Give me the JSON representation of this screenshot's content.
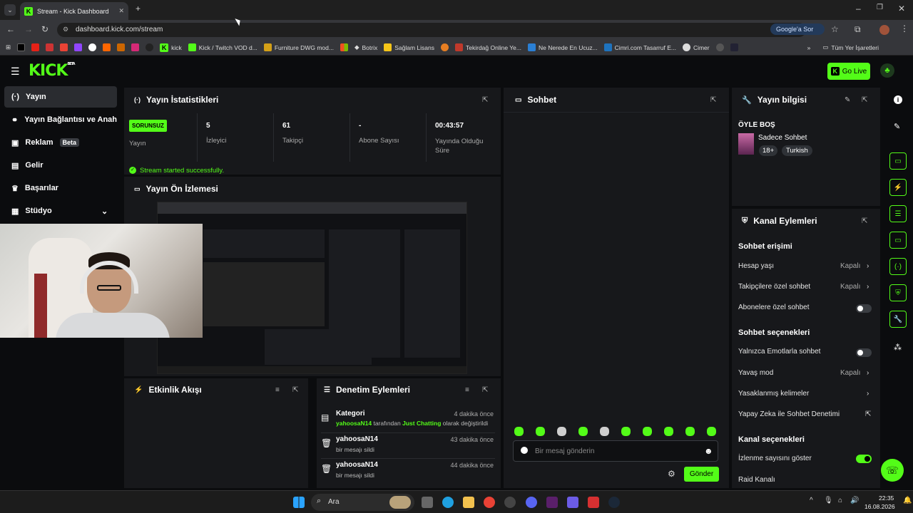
{
  "browser": {
    "tab_title": "Stream - Kick Dashboard",
    "url": "dashboard.kick.com/stream",
    "ask_google": "Google'a Sor",
    "bookmarks": [
      "kick",
      "Kick / Twitch VOD d...",
      "Furniture DWG mod...",
      "Botrix",
      "Sağlam Lisans",
      "Tekirdağ Online Ye...",
      "Ne Nerede En Ucuz...",
      "Cimri.com Tasarruf E...",
      "Cimer"
    ],
    "all_bookmarks": "Tüm Yer İşaretleri"
  },
  "app": {
    "logo": "KICK",
    "logo_sup": "BETA",
    "go_live": "Go Live"
  },
  "sidebar": {
    "items": [
      {
        "label": "Yayın",
        "icon": "broadcast-icon"
      },
      {
        "label": "Yayın Bağlantısı ve Anahtarı",
        "icon": "link-icon"
      },
      {
        "label": "Reklam",
        "icon": "ad-icon",
        "badge": "Beta"
      },
      {
        "label": "Gelir",
        "icon": "chart-icon"
      },
      {
        "label": "Başarılar",
        "icon": "trophy-icon"
      },
      {
        "label": "Stüdyo",
        "icon": "studio-icon"
      }
    ]
  },
  "stats": {
    "title": "Yayın İstatistikleri",
    "status_badge": "SORUNSUZ",
    "status_label": "Yayın",
    "viewers_value": "5",
    "viewers_label": "İzleyici",
    "followers_value": "61",
    "followers_label": "Takipçi",
    "subs_value": "-",
    "subs_label": "Abone Sayısı",
    "uptime_value": "00:43:57",
    "uptime_label": "Yayında Olduğu Süre",
    "success_msg": "Stream started successfully."
  },
  "preview": {
    "title": "Yayın Ön İzlemesi"
  },
  "activity": {
    "title": "Etkinlik Akışı"
  },
  "moderation": {
    "title": "Denetim Eylemleri",
    "items": [
      {
        "title": "Kategori",
        "time": "4 dakika önce",
        "user": "yahoosaN14",
        "mid": " tarafından ",
        "highlight": "Just Chatting",
        "tail": " olarak değiştirildi"
      },
      {
        "title": "yahoosaN14",
        "time": "43 dakika önce",
        "desc": "bir mesajı sildi"
      },
      {
        "title": "yahoosaN14",
        "time": "44 dakika önce",
        "desc": "bir mesajı sildi"
      }
    ]
  },
  "chat": {
    "title": "Sohbet",
    "placeholder": "Bir mesaj gönderin",
    "send": "Gönder"
  },
  "stream_info": {
    "title": "Yayın bilgisi",
    "stream_title": "ÖYLE BOŞ",
    "category": "Sadece Sohbet",
    "tags": [
      "18+",
      "Turkish"
    ]
  },
  "channel_actions": {
    "title": "Kanal Eylemleri",
    "chat_access": "Sohbet erişimi",
    "account_age": "Hesap yaşı",
    "account_age_val": "Kapalı",
    "followers_only": "Takipçilere özel sohbet",
    "followers_only_val": "Kapalı",
    "subs_only": "Abonelere özel sohbet",
    "chat_options": "Sohbet seçenekleri",
    "emotes_only": "Yalnızca Emotlarla sohbet",
    "slow_mode": "Yavaş mod",
    "slow_mode_val": "Kapalı",
    "banned_words": "Yasaklanmış kelimeler",
    "ai_moderation": "Yapay Zeka ile Sohbet Denetimi",
    "channel_options": "Kanal seçenekleri",
    "show_viewers": "İzlenme sayısını göster",
    "raid": "Raid Kanalı"
  },
  "taskbar": {
    "search": "Ara",
    "time": "22:35",
    "date": "16.08.2026"
  },
  "colors": {
    "accent": "#53fc18",
    "bg": "#0b0c0e",
    "panel": "#17181b"
  }
}
